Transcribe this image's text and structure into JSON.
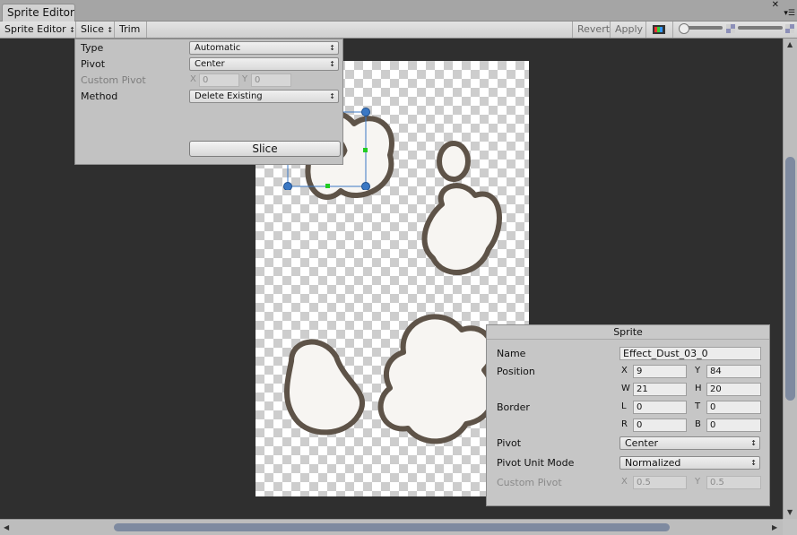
{
  "window": {
    "tab_title": "Sprite Editor"
  },
  "toolbar": {
    "mode_label": "Sprite Editor",
    "slice_label": "Slice",
    "trim_label": "Trim",
    "revert_label": "Revert",
    "apply_label": "Apply",
    "updown": "↕"
  },
  "slice_popup": {
    "type_label": "Type",
    "type_value": "Automatic",
    "pivot_label": "Pivot",
    "pivot_value": "Center",
    "custom_pivot_label": "Custom Pivot",
    "custom_pivot_x_axis": "X",
    "custom_pivot_x": "0",
    "custom_pivot_y_axis": "Y",
    "custom_pivot_y": "0",
    "method_label": "Method",
    "method_value": "Delete Existing",
    "slice_button": "Slice"
  },
  "sprite_panel": {
    "header": "Sprite",
    "name_label": "Name",
    "name_value": "Effect_Dust_03_0",
    "position_label": "Position",
    "x_axis": "X",
    "x_value": "9",
    "y_axis": "Y",
    "y_value": "84",
    "w_axis": "W",
    "w_value": "21",
    "h_axis": "H",
    "h_value": "20",
    "border_label": "Border",
    "l_axis": "L",
    "l_value": "0",
    "t_axis": "T",
    "t_value": "0",
    "r_axis": "R",
    "r_value": "0",
    "b_axis": "B",
    "b_value": "0",
    "pivot_label": "Pivot",
    "pivot_value": "Center",
    "pivot_unit_label": "Pivot Unit Mode",
    "pivot_unit_value": "Normalized",
    "custom_pivot_label": "Custom Pivot",
    "custom_x_axis": "X",
    "custom_x_value": "0.5",
    "custom_y_axis": "Y",
    "custom_y_value": "0.5"
  },
  "colors": {
    "canvas_bg": "#2f2f2f",
    "selection_blue": "#3b78c4",
    "pivot_green": "#22cc22",
    "scroll_thumb": "#7e8aa0"
  },
  "icons": {
    "close": "close-icon",
    "menu": "tab-menu-icon",
    "color_toggle": "rgb-toggle-icon",
    "alpha": "alpha-icon",
    "mip": "mip-icon"
  }
}
